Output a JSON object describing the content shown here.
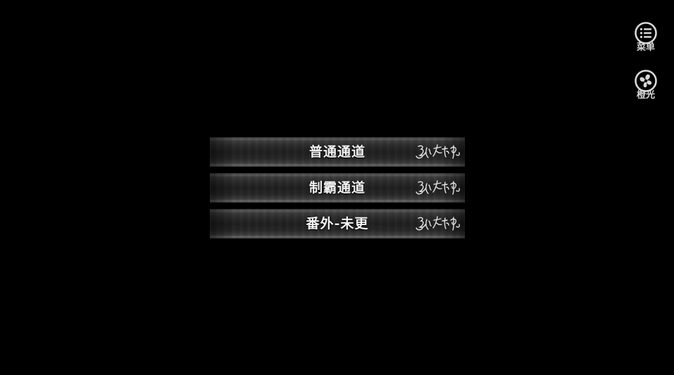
{
  "side_buttons": {
    "menu": {
      "label": "菜单",
      "icon": "list-icon"
    },
    "light": {
      "label": "橙光",
      "icon": "orange-light-logo-icon"
    }
  },
  "main_menu": {
    "items": [
      {
        "label": "普通通道",
        "signature": "张行中"
      },
      {
        "label": "制霸通道",
        "signature": "张行中"
      },
      {
        "label": "番外-未更",
        "signature": "张行中"
      }
    ]
  },
  "colors": {
    "background": "#000000",
    "text": "#f2f2f2",
    "icon": "#d8d8d8"
  }
}
